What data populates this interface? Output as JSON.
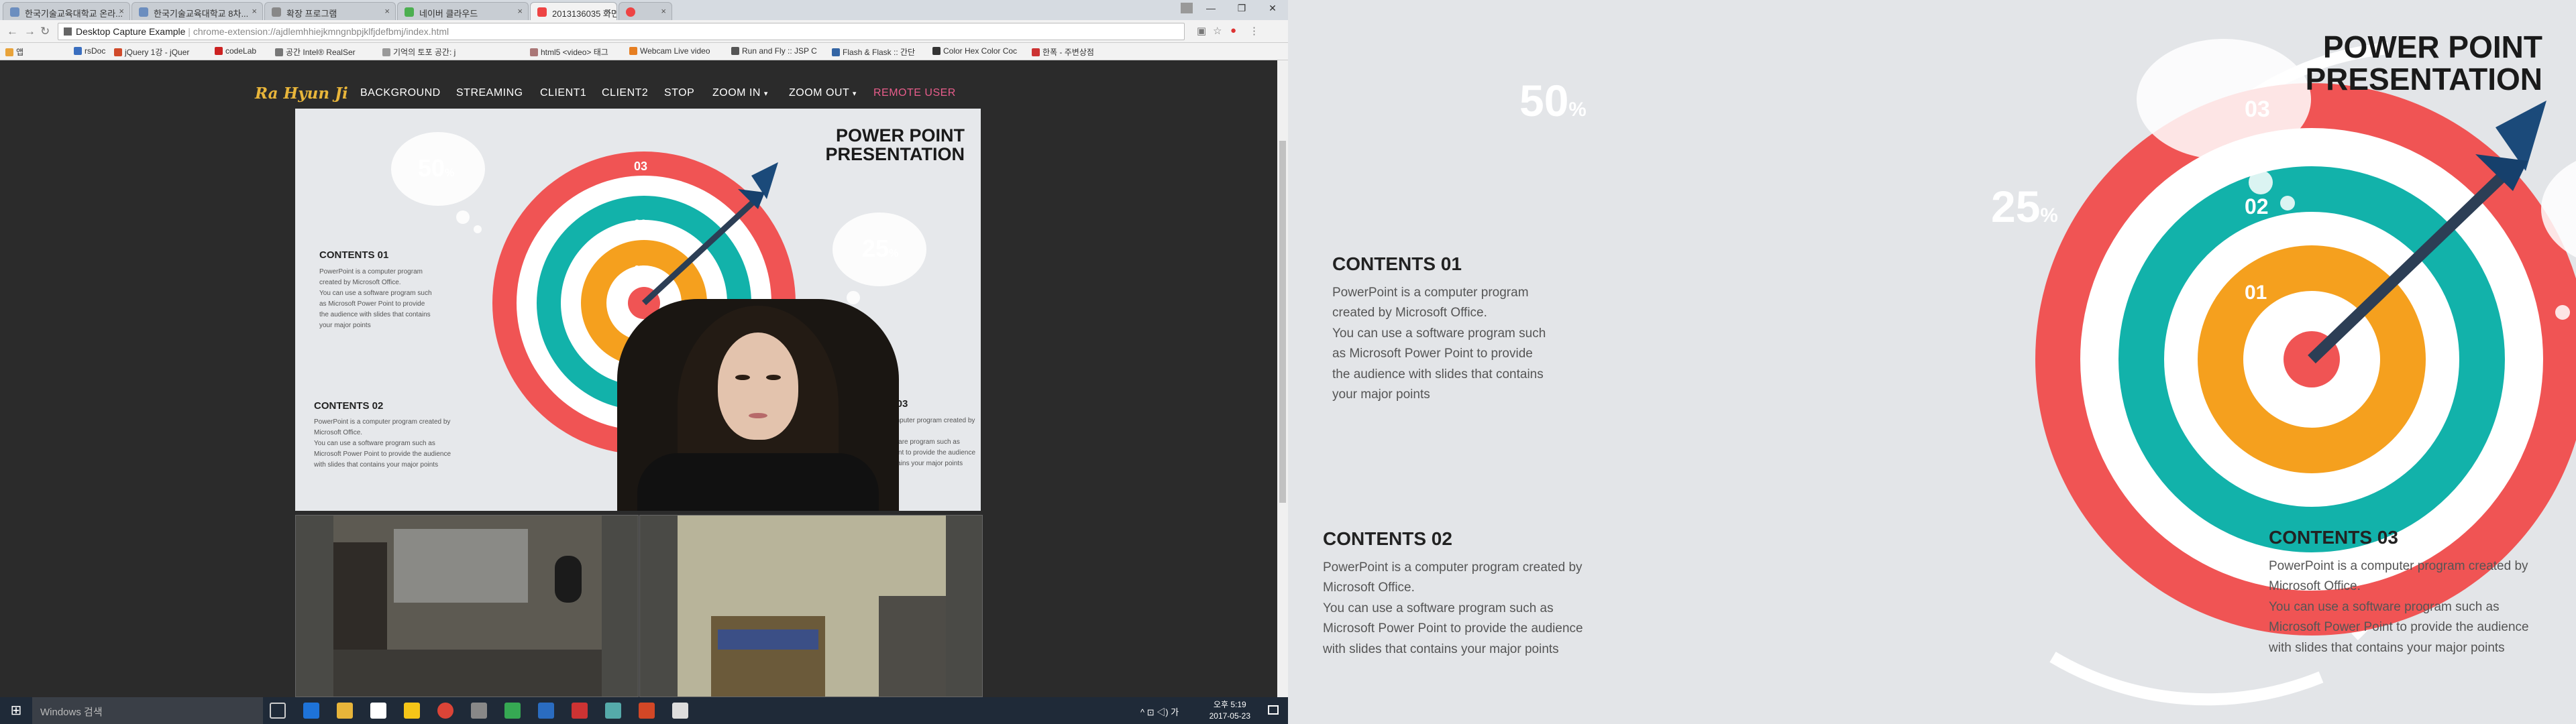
{
  "browser": {
    "tabs": [
      "한국기술교육대학교 온라...",
      "한국기술교육대학교 8차...",
      "확장 프로그램",
      "네이버 클라우드",
      "2013136035 화면지...",
      ""
    ],
    "url_host": "Desktop Capture Example",
    "url_path": "chrome-extension://ajdlemhhiejkmngnbpjklfjdefbmj/index.html",
    "window_controls": [
      "—",
      "❐",
      "✕"
    ],
    "bookmarks": [
      "앱",
      "rsDoc",
      "jQuery 1강 - jQuer",
      "codeLab",
      "공간 Intel® RealSer",
      "기억의 토포 공간: j",
      "html5 <video> 태그",
      "Webcam Live video",
      "Run and Fly :: JSP C",
      "Flash & Flask :: 간단",
      "Color Hex Color Coc",
      "한폭 - 주변상점"
    ]
  },
  "site": {
    "logo": "Ra Hyun Ji",
    "nav": [
      "BACKGROUND",
      "STREAMING",
      "CLIENT1",
      "CLIENT2",
      "STOP",
      "ZOOM IN",
      "ZOOM OUT",
      "REMOTE USER"
    ],
    "zoom_in_caret": "▾",
    "zoom_out_caret": "▾"
  },
  "slide": {
    "title_line1": "POWER POINT",
    "title_line2": "PRESENTATION",
    "bubble_left": "50",
    "bubble_right": "25",
    "percent": "%",
    "ring_labels": [
      "01",
      "02",
      "03"
    ],
    "contents": [
      {
        "heading": "CONTENTS 01",
        "lines": [
          "PowerPoint is a computer program",
          "created by Microsoft Office.",
          "You can use a software program such",
          "as Microsoft Power Point to provide",
          "the audience with slides that contains",
          "your major points"
        ]
      },
      {
        "heading": "CONTENTS 02",
        "lines": [
          "PowerPoint is a computer program created by",
          "Microsoft Office.",
          "You can use a software program such as",
          "Microsoft Power Point to provide the audience",
          "with slides that contains your major points"
        ]
      },
      {
        "heading": "CONTENTS 03",
        "lines": [
          "PowerPoint is a computer program created by",
          "Microsoft Office.",
          "You can use a software program such as",
          "Microsoft Power Point to provide the audience",
          "with slides that contains your major points"
        ]
      }
    ],
    "colors": {
      "red": "#f05454",
      "teal": "#12b2aa",
      "orange": "#f5a01e",
      "navy": "#1b4a7a"
    }
  },
  "taskbar": {
    "search_placeholder": "Windows 검색",
    "time": "오후 5:19",
    "date": "2017-05-23",
    "tray": "^  ⊡  ◁)  가"
  }
}
